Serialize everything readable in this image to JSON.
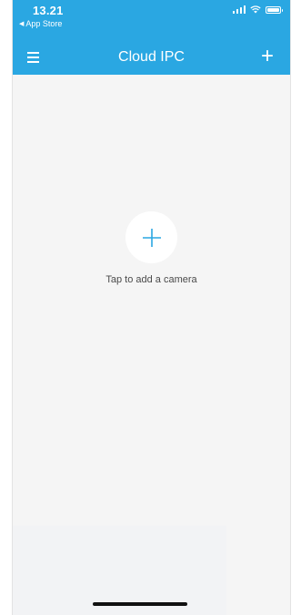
{
  "status_bar": {
    "time": "13.21",
    "back_app": "App Store",
    "icons": [
      "signal-icon",
      "wifi-icon",
      "battery-icon"
    ]
  },
  "nav": {
    "title": "Cloud IPC",
    "menu_icon": "hamburger-menu-icon",
    "add_icon": "plus-icon",
    "add_glyph": "+"
  },
  "empty_state": {
    "add_icon": "plus-icon",
    "label": "Tap to add a camera"
  },
  "colors": {
    "accent": "#2aa7e2",
    "background": "#f5f5f5",
    "text": "#4a4a4a"
  }
}
